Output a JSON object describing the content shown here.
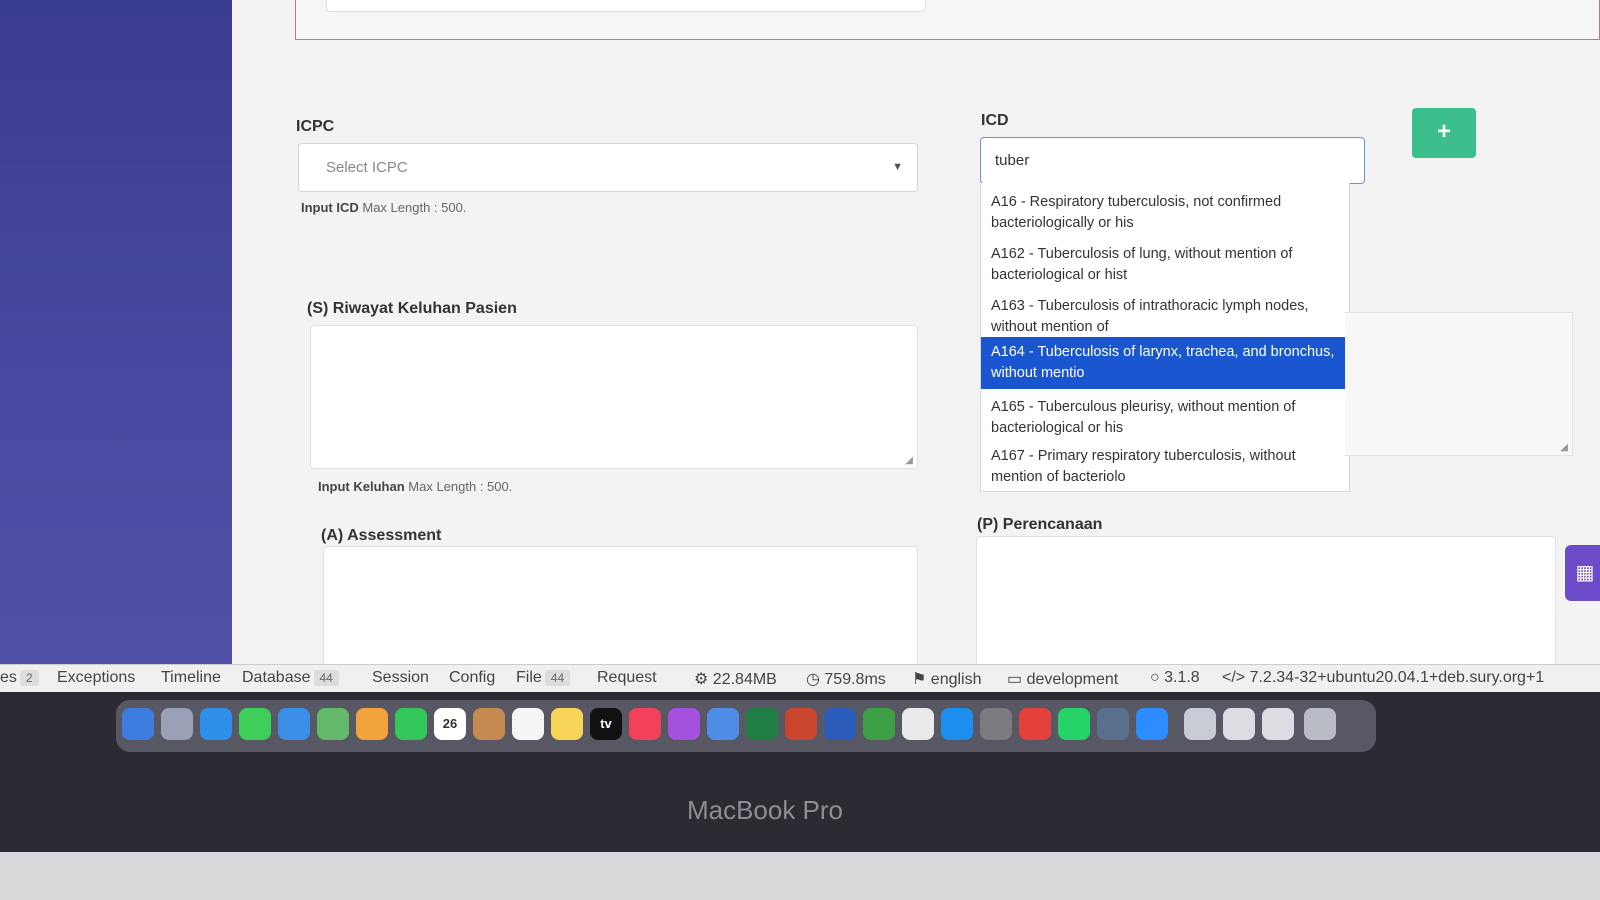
{
  "form": {
    "icpc": {
      "label": "ICPC",
      "placeholder": "Select ICPC",
      "hint_bold": "Input ICD",
      "hint_rest": " Max Length : 500."
    },
    "icd": {
      "label": "ICD",
      "value": "tuber",
      "options": [
        {
          "text": "A16 - Respiratory tuberculosis, not confirmed bacteriologically or his"
        },
        {
          "text": "A162 - Tuberculosis of lung, without mention of bacteriological or hist"
        },
        {
          "text": "A163 - Tuberculosis of intrathoracic lymph nodes, without mention of"
        },
        {
          "text": "A164 - Tuberculosis of larynx, trachea, and bronchus, without mentio",
          "selected": true
        },
        {
          "text": "A165 - Tuberculous pleurisy, without mention of bacteriological or his"
        },
        {
          "text": "A167 - Primary respiratory tuberculosis, without mention of bacteriolo"
        }
      ]
    },
    "subjective": {
      "label": "(S) Riwayat Keluhan Pasien",
      "hint_bold": "Input Keluhan",
      "hint_rest": " Max Length : 500."
    },
    "assessment": {
      "label": "(A) Assessment"
    },
    "planning": {
      "label": "(P) Perencanaan"
    },
    "add_button": "+"
  },
  "debugbar": {
    "items": [
      {
        "label": "es",
        "badge": "2"
      },
      {
        "label": "Exceptions"
      },
      {
        "label": "Timeline"
      },
      {
        "label": "Database",
        "badge": "44"
      },
      {
        "label": "Session"
      },
      {
        "label": "Config"
      },
      {
        "label": "File",
        "badge": "44"
      },
      {
        "label": "Request"
      }
    ],
    "memory": "22.84MB",
    "time": "759.8ms",
    "locale": "english",
    "env": "development",
    "version": "3.1.8",
    "php": "7.2.34-32+ubuntu20.04.1+deb.sury.org+1"
  },
  "dock": {
    "calendar_day": "26",
    "tv_label": "tv"
  },
  "device": {
    "label": "MacBook Pro"
  },
  "colors": {
    "sidebar": "#3a3b8f",
    "selected_option": "#1a56cf",
    "add_button": "#3cbf8c",
    "invalid_border": "#e06a7a"
  }
}
